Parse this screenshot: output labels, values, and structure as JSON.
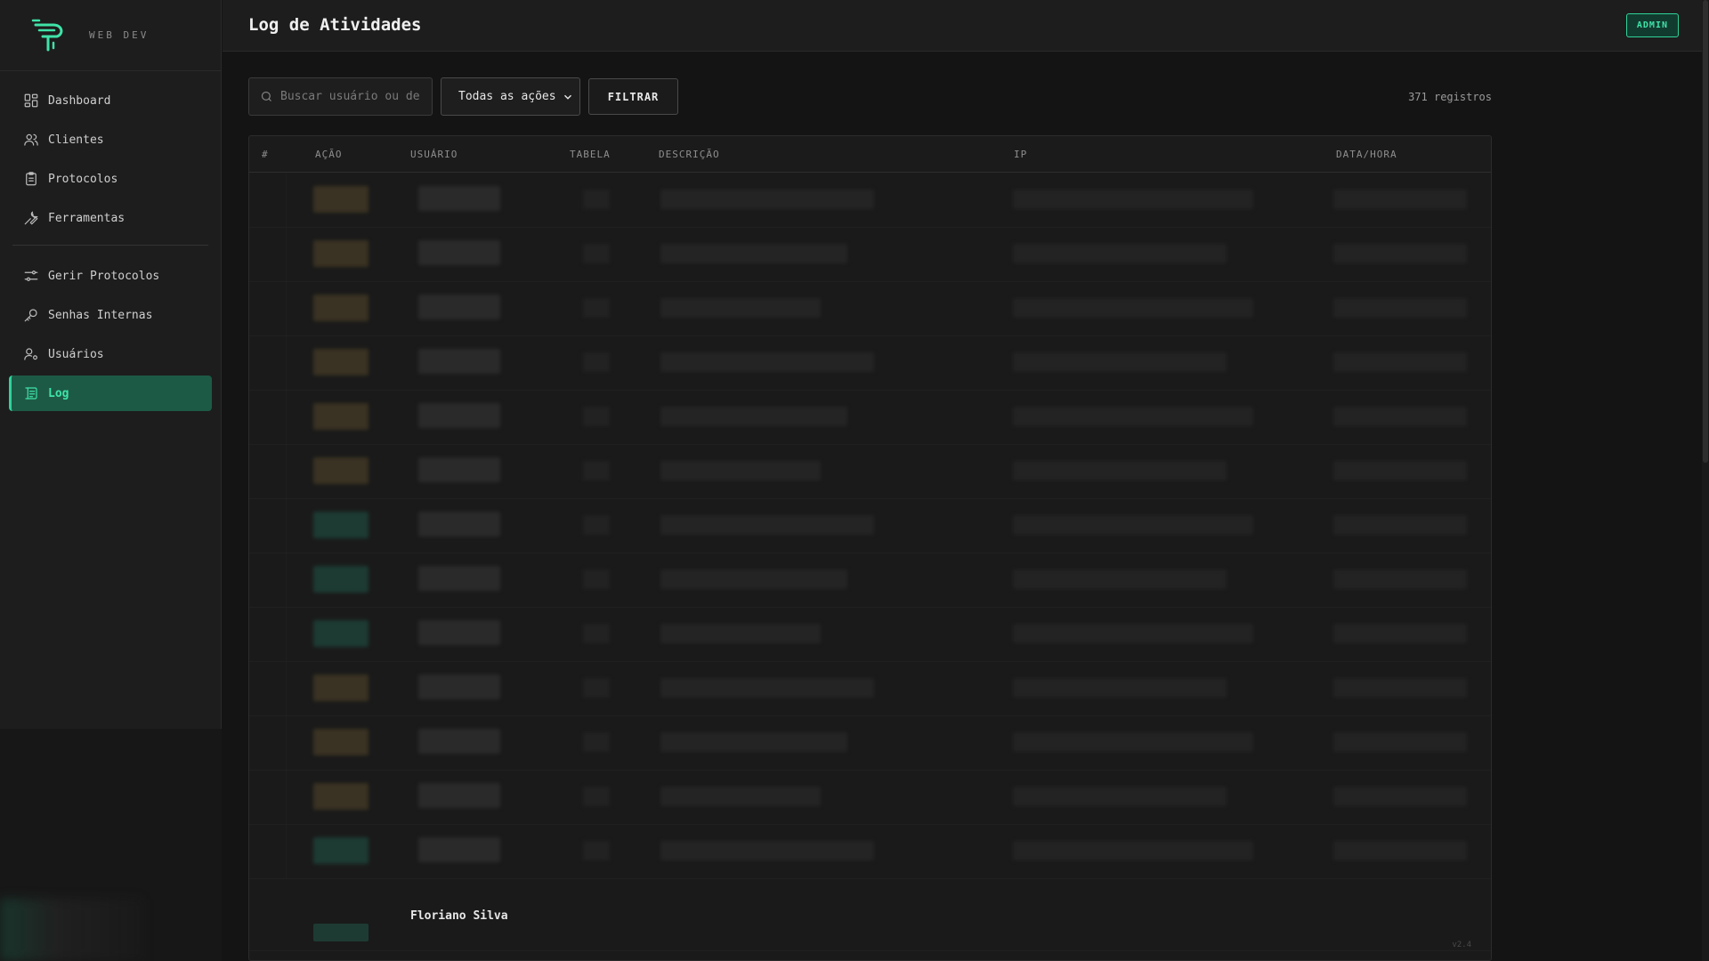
{
  "brand": {
    "text": "WEB DEV"
  },
  "nav": {
    "main": [
      {
        "label": "Dashboard",
        "icon": "dashboard-icon"
      },
      {
        "label": "Clientes",
        "icon": "users-icon"
      },
      {
        "label": "Protocolos",
        "icon": "clipboard-icon"
      },
      {
        "label": "Ferramentas",
        "icon": "wrench-icon"
      }
    ],
    "admin": [
      {
        "label": "Gerir Protocolos",
        "icon": "sliders-icon"
      },
      {
        "label": "Senhas Internas",
        "icon": "key-icon"
      },
      {
        "label": "Usuários",
        "icon": "user-gear-icon"
      },
      {
        "label": "Log",
        "icon": "log-icon"
      }
    ]
  },
  "header": {
    "title": "Log de Atividades",
    "badge": "ADMIN"
  },
  "toolbar": {
    "search_placeholder": "Buscar usuário ou de",
    "select_value": "Todas as ações",
    "filter_label": "FILTRAR",
    "records": "371 registros"
  },
  "table": {
    "columns": [
      "#",
      "AÇÃO",
      "USUÁRIO",
      "TABELA",
      "DESCRIÇÃO",
      "IP",
      "DATA/HORA"
    ],
    "last_row_user": "Floriano Silva"
  },
  "colors": {
    "accent": "#2fd39a",
    "action_amber": "#3a3222",
    "action_teal": "#1d3b33"
  }
}
